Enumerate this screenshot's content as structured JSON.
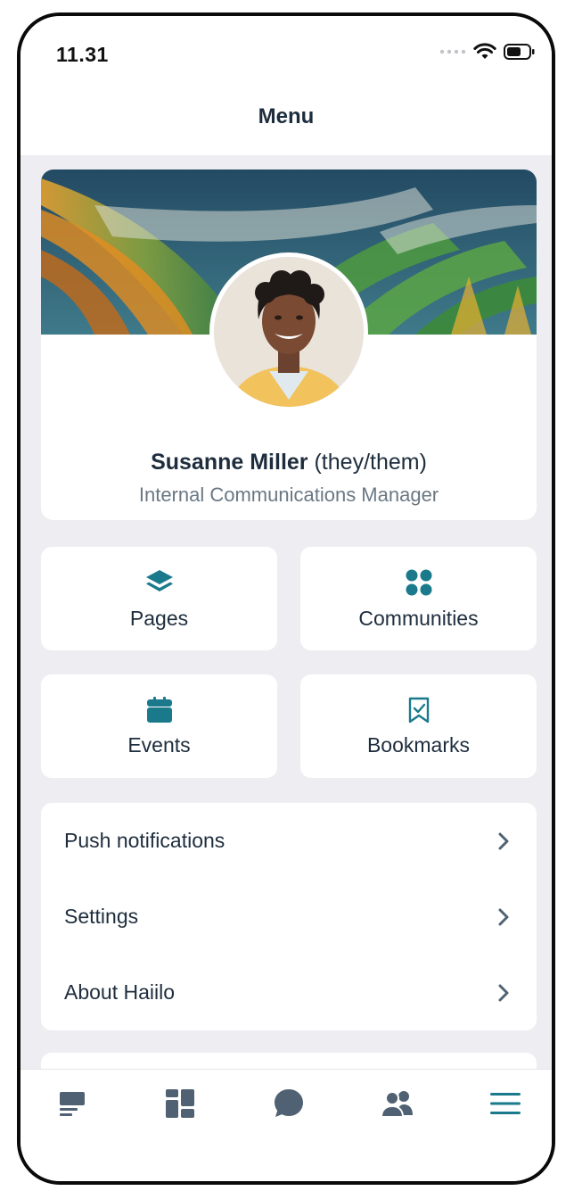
{
  "status_bar": {
    "time": "11.31",
    "icons": [
      "signal-dots-icon",
      "wifi-icon",
      "battery-icon"
    ]
  },
  "header": {
    "title": "Menu"
  },
  "profile": {
    "name": "Susanne Miller",
    "pronouns": "(they/them)",
    "role": "Internal Communications Manager"
  },
  "tiles": [
    {
      "label": "Pages",
      "icon": "layers-icon"
    },
    {
      "label": "Communities",
      "icon": "communities-icon"
    },
    {
      "label": "Events",
      "icon": "calendar-icon"
    },
    {
      "label": "Bookmarks",
      "icon": "bookmark-check-icon"
    }
  ],
  "menu_items": [
    {
      "label": "Push notifications"
    },
    {
      "label": "Settings"
    },
    {
      "label": "About Haiilo"
    }
  ],
  "tab_bar": {
    "tabs": [
      "timeline-icon",
      "pages-grid-icon",
      "chat-icon",
      "colleagues-icon",
      "menu-icon"
    ],
    "active": "menu-icon"
  },
  "colors": {
    "accent": "#1a7a8c",
    "text": "#1e2d3d",
    "muted": "#6a7884",
    "background": "#eeeef2",
    "tab_inactive": "#4f6172"
  }
}
